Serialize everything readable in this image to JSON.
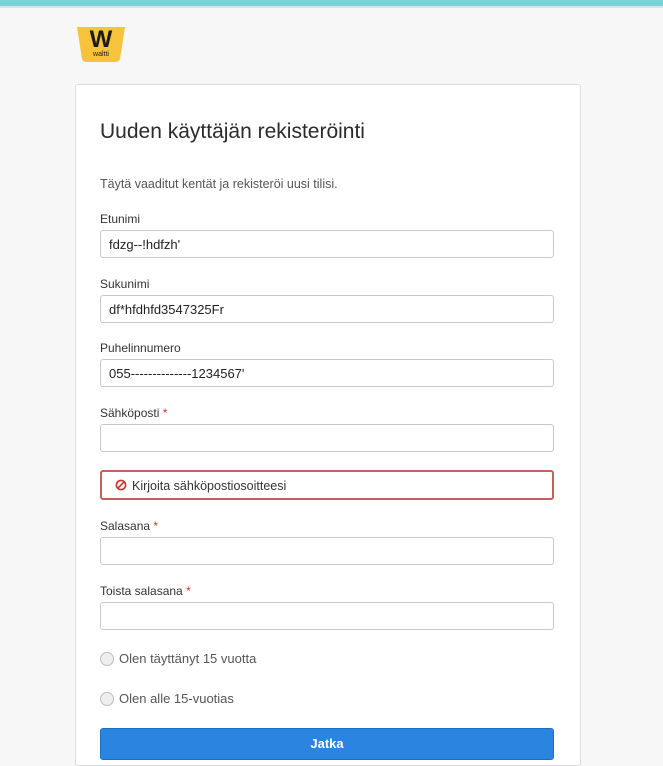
{
  "brand": {
    "logo_letter": "W",
    "logo_text": "waltti",
    "logo_color": "#f8c33c"
  },
  "form": {
    "title": "Uuden käyttäjän rekisteröinti",
    "subtitle": "Täytä vaaditut kentät ja rekisteröi uusi tilisi.",
    "fields": {
      "first_name": {
        "label": "Etunimi",
        "value": "fdzg--!hdfzh'"
      },
      "last_name": {
        "label": "Sukunimi",
        "value": "df*hfdhfd3547325Fr"
      },
      "phone": {
        "label": "Puhelinnumero",
        "value": "055--------------1234567'"
      },
      "email": {
        "label": "Sähköposti",
        "required_mark": "*",
        "value": ""
      },
      "password": {
        "label": "Salasana",
        "required_mark": "*",
        "value": ""
      },
      "password_repeat": {
        "label": "Toista salasana",
        "required_mark": "*",
        "value": ""
      }
    },
    "email_error": "Kirjoita sähköpostiosoitteesi",
    "age_options": {
      "over_15": "Olen täyttänyt 15 vuotta",
      "under_15": "Olen alle 15-vuotias"
    },
    "submit_label": "Jatka"
  },
  "colors": {
    "accent_bar": "#7ad1d6",
    "error_border": "#c1625d",
    "primary_button": "#2b85e0",
    "required": "#c0392b"
  }
}
